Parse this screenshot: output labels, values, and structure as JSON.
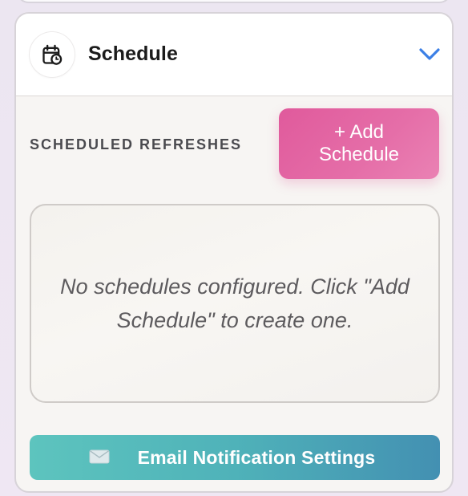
{
  "header": {
    "title": "Schedule",
    "icon": "calendar-clock-icon",
    "toggle_icon": "chevron-down-icon",
    "accent_color": "#3b7fe6"
  },
  "scheduled": {
    "section_label": "SCHEDULED REFRESHES",
    "add_button_label": "+ Add Schedule",
    "empty_message": "No schedules configured. Click \"Add Schedule\" to create one."
  },
  "email": {
    "button_label": "Email Notification Settings",
    "icon": "envelope-icon"
  },
  "colors": {
    "add_button": "#e05a9c",
    "email_button_start": "#5dc4be",
    "email_button_end": "#4390b2"
  }
}
